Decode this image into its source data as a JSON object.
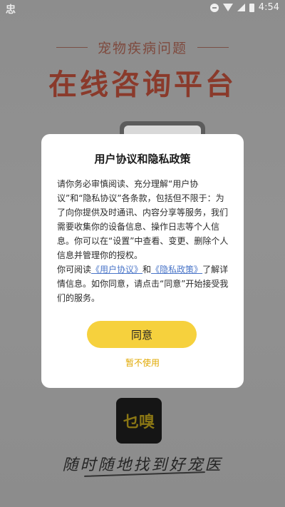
{
  "status_bar": {
    "app_icon_text": "忠",
    "time": "4:54",
    "icons": [
      "dnd-icon",
      "wifi-icon",
      "signal-icon",
      "battery-icon"
    ]
  },
  "splash": {
    "subtitle": "宠物疾病问题",
    "headline": "在线咨询平台",
    "logo_text": "乜嗅",
    "slogan": "随时随地找到好宠医"
  },
  "dialog": {
    "title": "用户协议和隐私政策",
    "body_intro": "请你务必审慎阅读、充分理解“用户协议”和“隐私协议”各条款，包括但不限于：为了向你提供及时通讯、内容分享等服务，我们需要收集你的设备信息、操作日志等个人信息。你可以在“设置”中查看、变更、删除个人信息并管理你的授权。",
    "read_prefix": "你可阅读",
    "user_agreement_link": "《用户协议》",
    "and": "和",
    "privacy_policy_link": "《隐私政策》",
    "read_suffix": "了解详情信息。如你同意，请点击“同意”开始接受我们的服务。",
    "agree_label": "同意",
    "decline_label": "暂不使用"
  },
  "colors": {
    "accent_yellow": "#f6d13d",
    "link_blue": "#4a75c8",
    "decline_orange": "#e0a800"
  }
}
